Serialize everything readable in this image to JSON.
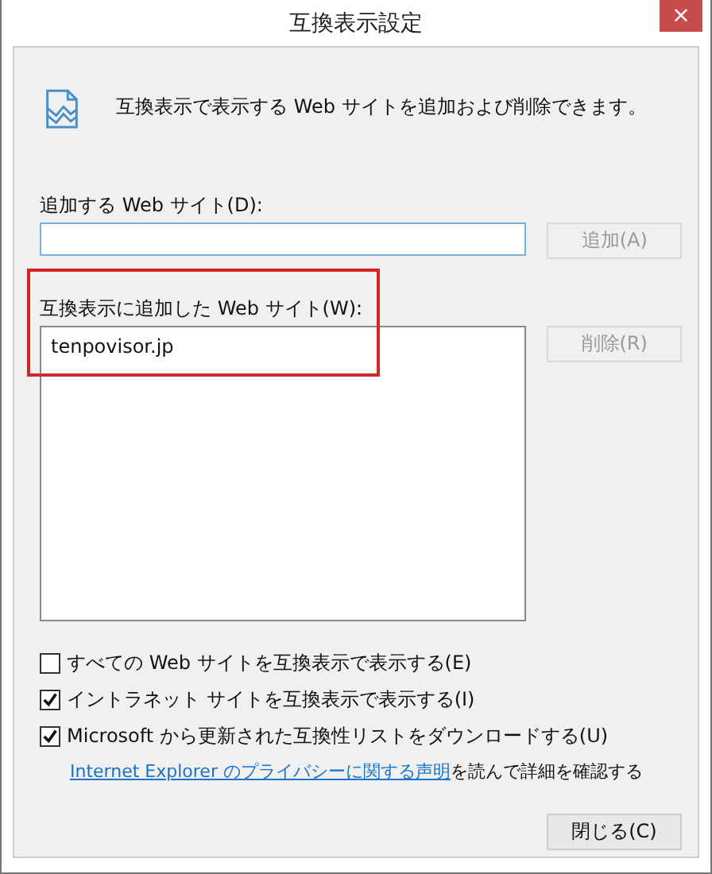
{
  "window": {
    "title": "互換表示設定",
    "close": "×"
  },
  "description": "互換表示で表示する Web サイトを追加および削除できます。",
  "add_site": {
    "label": "追加する Web サイト(D):",
    "button": {
      "label": "追加(A)",
      "disabled": true
    }
  },
  "sites_list": {
    "label": "互換表示に追加した Web サイト(W):",
    "highlighted": true,
    "items": [
      "tenpovisor.jp"
    ],
    "button": {
      "label": "削除(R)",
      "disabled": true
    }
  },
  "options": [
    {
      "label": "すべての Web サイトを互換表示で表示する(E)",
      "checked": false
    },
    {
      "label": "イントラネット サイトを互換表示で表示する(I)",
      "checked": true
    },
    {
      "label": "Microsoft から更新された互換性リストをダウンロードする(U)",
      "checked": true
    }
  ],
  "privacy": {
    "link": "Internet Explorer のプライバシーに関する声明",
    "text": "を読んで詳細を確認する"
  },
  "buttons": [
    {
      "label": "閉じる(C)",
      "disabled": false
    }
  ]
}
